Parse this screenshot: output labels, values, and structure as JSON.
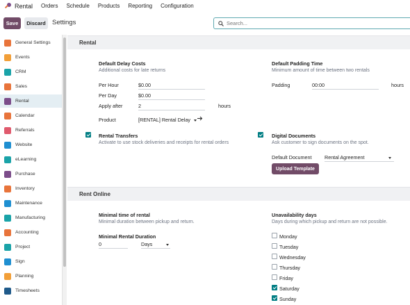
{
  "app": {
    "name": "Rental"
  },
  "nav": [
    "Orders",
    "Schedule",
    "Products",
    "Reporting",
    "Configuration"
  ],
  "control": {
    "save": "Save",
    "discard": "Discard",
    "title": "Settings",
    "search_placeholder": "Search..."
  },
  "sidebar": [
    {
      "label": "General Settings",
      "color": "#e8743b"
    },
    {
      "label": "Events",
      "color": "#f29f38"
    },
    {
      "label": "CRM",
      "color": "#1aa3a8"
    },
    {
      "label": "Sales",
      "color": "#e8743b"
    },
    {
      "label": "Rental",
      "color": "#7c4d8a"
    },
    {
      "label": "Calendar",
      "color": "#e8743b"
    },
    {
      "label": "Referrals",
      "color": "#e05a6d"
    },
    {
      "label": "Website",
      "color": "#1f8fd1"
    },
    {
      "label": "eLearning",
      "color": "#1aa3a8"
    },
    {
      "label": "Purchase",
      "color": "#7c4d8a"
    },
    {
      "label": "Inventory",
      "color": "#e8743b"
    },
    {
      "label": "Maintenance",
      "color": "#1f8fd1"
    },
    {
      "label": "Manufacturing",
      "color": "#1aa3a8"
    },
    {
      "label": "Accounting",
      "color": "#e8743b"
    },
    {
      "label": "Project",
      "color": "#1aa3a8"
    },
    {
      "label": "Sign",
      "color": "#1f8fd1"
    },
    {
      "label": "Planning",
      "color": "#f29f38"
    },
    {
      "label": "Timesheets",
      "color": "#1f5a8a"
    }
  ],
  "rental": {
    "heading": "Rental",
    "delay": {
      "title": "Default Delay Costs",
      "desc": "Additional costs for late returns",
      "per_hour_label": "Per Hour",
      "per_hour": "$0.00",
      "per_day_label": "Per Day",
      "per_day": "$0.00",
      "apply_label": "Apply after",
      "apply": "2",
      "apply_unit": "hours",
      "product_label": "Product",
      "product": "[RENTAL] Rental Delay"
    },
    "padding": {
      "title": "Default Padding Time",
      "desc": "Minimum amount of time between two rentals",
      "label": "Padding",
      "value": "00:00",
      "unit": "hours"
    },
    "transfers": {
      "title": "Rental Transfers",
      "desc": "Activate to use stock deliveries and receipts for rental orders",
      "checked": true
    },
    "documents": {
      "title": "Digital Documents",
      "desc": "Ask customer to sign documents on the spot.",
      "checked": true,
      "default_label": "Default Document",
      "default_value": "Rental Agreement",
      "upload": "Upload Template"
    }
  },
  "online": {
    "heading": "Rent Online",
    "minimal": {
      "title": "Minimal time of rental",
      "desc": "Minimal duration between pickup and return.",
      "field_label": "Minimal Rental Duration",
      "value": "0",
      "unit": "Days"
    },
    "unavailability": {
      "title": "Unavailability days",
      "desc": "Days during which pickup and return are not possible.",
      "days": [
        {
          "label": "Monday",
          "checked": false
        },
        {
          "label": "Tuesday",
          "checked": false
        },
        {
          "label": "Wednesday",
          "checked": false
        },
        {
          "label": "Thursday",
          "checked": false
        },
        {
          "label": "Friday",
          "checked": false
        },
        {
          "label": "Saturday",
          "checked": true
        },
        {
          "label": "Sunday",
          "checked": true
        }
      ]
    }
  }
}
